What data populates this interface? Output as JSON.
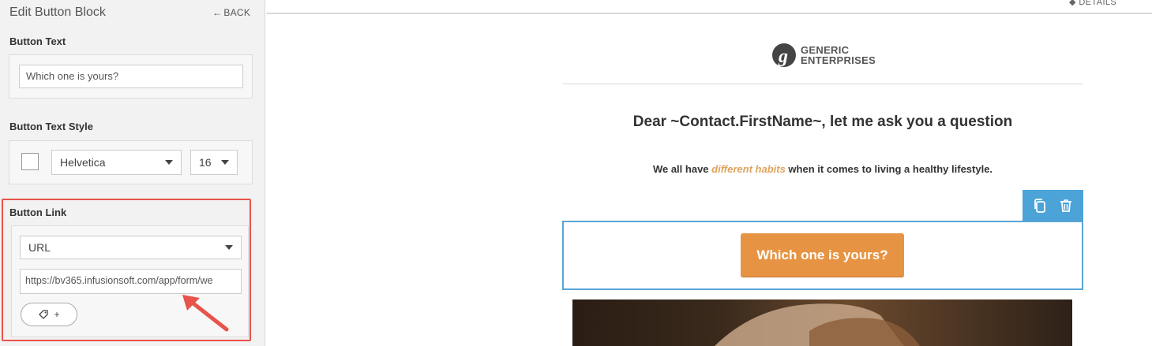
{
  "panel": {
    "title": "Edit Button Block",
    "back_label": "BACK",
    "button_text": {
      "label": "Button Text",
      "value": "Which one is yours?"
    },
    "text_style": {
      "label": "Button Text Style",
      "font": "Helvetica",
      "size": "16"
    },
    "button_link": {
      "label": "Button Link",
      "type": "URL",
      "url": "https://bv365.infusionsoft.com/app/form/we",
      "tag_button_label": "+"
    }
  },
  "editor": {
    "details_label": "DETAILS",
    "logo": {
      "line1": "GENERIC",
      "line2": "ENTERPRISES"
    },
    "heading": "Dear ~Contact.FirstName~, let me ask you a question",
    "paragraph": {
      "before": "We all have ",
      "emphasis": "different habits",
      "after": " when it comes to living a healthy lifestyle."
    },
    "cta_label": "Which one is yours?"
  },
  "colors": {
    "cta": "#e69443",
    "selection": "#4ba3d8",
    "highlight": "#e8534a",
    "emphasis": "#e0a35d"
  }
}
